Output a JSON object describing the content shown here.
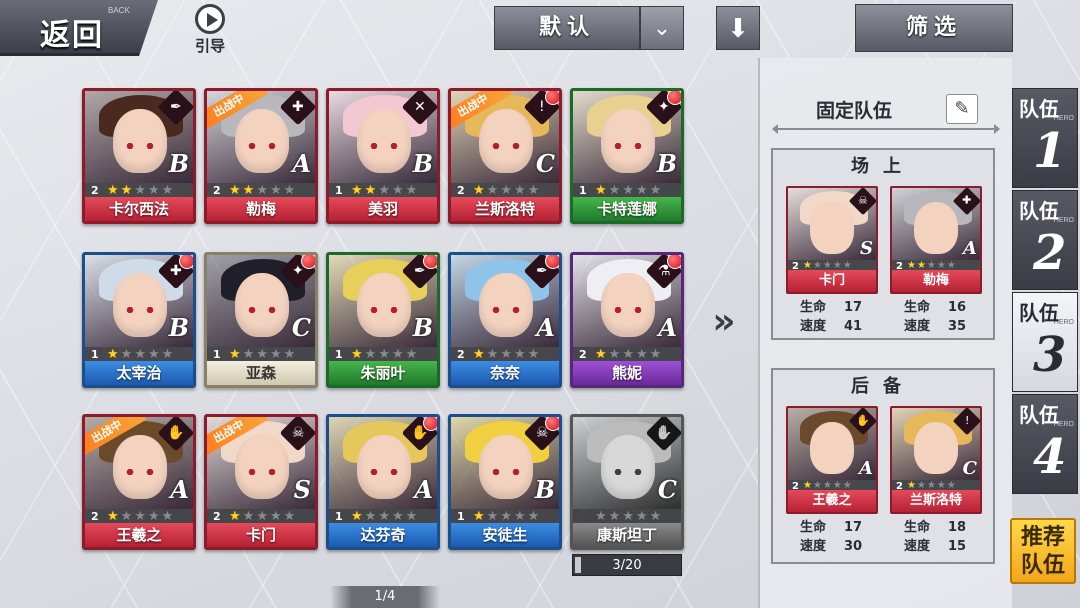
{
  "topbar": {
    "back_label": "返回",
    "back_sub": "BACK",
    "guide_label": "引导",
    "sort_label": "默认",
    "sort_arrow_icon": "chevron-down-icon",
    "down_icon": "arrow-down-icon",
    "filter_label": "筛选"
  },
  "sortie_tag": "出战中",
  "cards": [
    {
      "name": "卡尔西法",
      "level": "2",
      "stars": 2,
      "grade": "B",
      "color": "red",
      "icon": "✒",
      "dot": false,
      "sortie": false,
      "hair": "#4a2a20"
    },
    {
      "name": "勒梅",
      "level": "2",
      "stars": 2,
      "grade": "A",
      "color": "red",
      "icon": "✚",
      "dot": false,
      "sortie": true,
      "hair": "#b8b8bc"
    },
    {
      "name": "美羽",
      "level": "1",
      "stars": 2,
      "grade": "B",
      "color": "red",
      "icon": "✕",
      "dot": false,
      "sortie": false,
      "hair": "#f2c8d2"
    },
    {
      "name": "兰斯洛特",
      "level": "2",
      "stars": 1,
      "grade": "C",
      "color": "red",
      "icon": "!",
      "dot": true,
      "sortie": true,
      "hair": "#e6b85a"
    },
    {
      "name": "卡特莲娜",
      "level": "1",
      "stars": 1,
      "grade": "B",
      "color": "green",
      "icon": "✦",
      "dot": true,
      "sortie": false,
      "hair": "#e8d090"
    },
    {
      "name": "太宰治",
      "level": "1",
      "stars": 1,
      "grade": "B",
      "color": "blue",
      "icon": "✚",
      "dot": true,
      "sortie": false,
      "hair": "#cfdbe8"
    },
    {
      "name": "亚森",
      "level": "1",
      "stars": 1,
      "grade": "C",
      "color": "cream",
      "icon": "✦",
      "dot": true,
      "sortie": false,
      "hair": "#1f1f2a"
    },
    {
      "name": "朱丽叶",
      "level": "1",
      "stars": 1,
      "grade": "B",
      "color": "green",
      "icon": "✒",
      "dot": true,
      "sortie": false,
      "hair": "#e8cf5a"
    },
    {
      "name": "奈奈",
      "level": "2",
      "stars": 1,
      "grade": "A",
      "color": "blue",
      "icon": "✒",
      "dot": true,
      "sortie": false,
      "hair": "#8fc4ea"
    },
    {
      "name": "熊妮",
      "level": "2",
      "stars": 1,
      "grade": "A",
      "color": "purple",
      "icon": "⚗",
      "dot": true,
      "sortie": false,
      "hair": "#eeeef4"
    },
    {
      "name": "王羲之",
      "level": "2",
      "stars": 1,
      "grade": "A",
      "color": "red",
      "icon": "✋",
      "dot": false,
      "sortie": true,
      "hair": "#6a4a2a"
    },
    {
      "name": "卡门",
      "level": "2",
      "stars": 1,
      "grade": "S",
      "color": "red",
      "icon": "☠",
      "dot": false,
      "sortie": true,
      "hair": "#f2d8c8"
    },
    {
      "name": "达芬奇",
      "level": "1",
      "stars": 1,
      "grade": "A",
      "color": "blue",
      "icon": "✋",
      "dot": true,
      "sortie": false,
      "hair": "#e6c85a"
    },
    {
      "name": "安徒生",
      "level": "1",
      "stars": 1,
      "grade": "B",
      "color": "blue",
      "icon": "☠",
      "dot": true,
      "sortie": false,
      "hair": "#f0d040"
    },
    {
      "name": "康斯坦丁",
      "level": "",
      "stars": 0,
      "grade": "C",
      "color": "gray",
      "icon": "✋",
      "dot": false,
      "sortie": false,
      "hair": "#bbbbbb"
    }
  ],
  "collection_count": "3/20",
  "page_indicator": "1/4",
  "panel": {
    "fixed_team_label": "固定队伍",
    "edit_icon": "pencil-icon",
    "on_field_label": "场上",
    "reserve_label": "后备",
    "stat_hp_label": "生命",
    "stat_speed_label": "速度",
    "on_field": [
      {
        "name": "卡门",
        "level": "2",
        "stars": 1,
        "grade": "S",
        "icon": "☠",
        "hp": "17",
        "speed": "41",
        "hair": "#f2d8c8"
      },
      {
        "name": "勒梅",
        "level": "2",
        "stars": 2,
        "grade": "A",
        "icon": "✚",
        "hp": "16",
        "speed": "35",
        "hair": "#b8b8bc"
      }
    ],
    "reserve": [
      {
        "name": "王羲之",
        "level": "2",
        "stars": 1,
        "grade": "A",
        "icon": "✋",
        "hp": "17",
        "speed": "30",
        "hair": "#6a4a2a"
      },
      {
        "name": "兰斯洛特",
        "level": "2",
        "stars": 1,
        "grade": "C",
        "icon": "!",
        "hp": "18",
        "speed": "15",
        "hair": "#e6b85a"
      }
    ]
  },
  "team_tabs": [
    {
      "label": "队伍",
      "num": "1",
      "active": false
    },
    {
      "label": "队伍",
      "num": "2",
      "active": false
    },
    {
      "label": "队伍",
      "num": "3",
      "active": true
    },
    {
      "label": "队伍",
      "num": "4",
      "active": false
    }
  ],
  "tab_hero_text": "HERO",
  "recommend_label": "推荐队伍"
}
